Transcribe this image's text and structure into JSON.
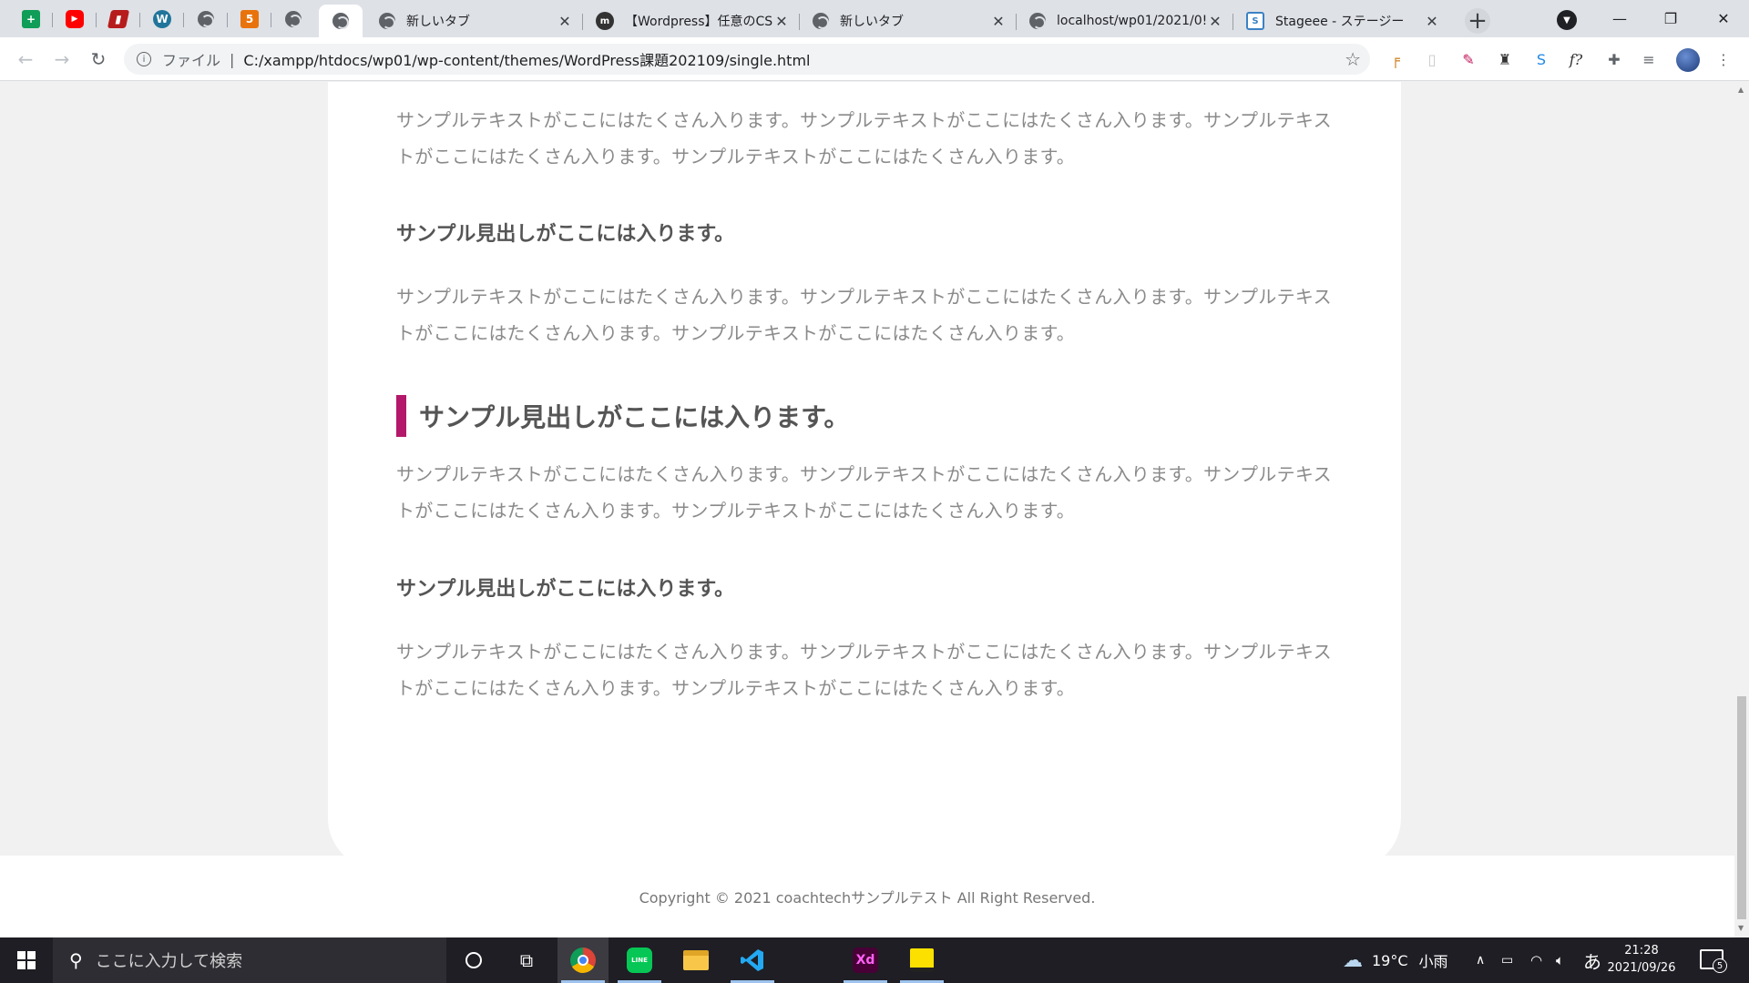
{
  "browser": {
    "pinned_tabs": [
      {
        "icon": "google-sheets-icon",
        "color": "#0f9d58",
        "glyph": "+"
      },
      {
        "icon": "youtube-icon",
        "color": "#ff0000",
        "glyph": "▶"
      },
      {
        "icon": "book-icon",
        "color": "#b71c1c",
        "glyph": "▮"
      },
      {
        "icon": "wordpress-icon",
        "color": "#21759b",
        "glyph": "W"
      },
      {
        "icon": "globe-icon"
      },
      {
        "icon": "html5-icon",
        "color": "#e8730c",
        "glyph": "5"
      },
      {
        "icon": "globe-icon"
      }
    ],
    "tabs": [
      {
        "title": "新しいタブ"
      },
      {
        "title": "【Wordpress】任意のCSS:"
      },
      {
        "title": "新しいタブ"
      },
      {
        "title": "localhost/wp01/2021/0!"
      },
      {
        "title": "Stageee - ステージー"
      }
    ],
    "new_tab": "+",
    "window": {
      "minimize": "—",
      "restore": "❐",
      "close": "✕"
    },
    "address": {
      "scheme_label": "ファイル",
      "url": "C:/xampp/htdocs/wp01/wp-content/themes/WordPress課題202109/single.html"
    },
    "extensions": [
      "ruler-icon",
      "bookmark-icon",
      "eyedropper-icon",
      "stamp-icon",
      "stylus-icon",
      "font-icon",
      "puzzle-icon",
      "media-control-icon"
    ],
    "font_ext_label": "f?"
  },
  "page": {
    "accent_color": "#b4186a",
    "blocks": [
      {
        "type": "p",
        "text": "サンプルテキストがここにはたくさん入ります。サンプルテキストがここにはたくさん入ります。サンプルテキストがここにはたくさん入ります。サンプルテキストがここにはたくさん入ります。"
      },
      {
        "type": "h3",
        "text": "サンプル見出しがここには入ります。"
      },
      {
        "type": "p",
        "text": "サンプルテキストがここにはたくさん入ります。サンプルテキストがここにはたくさん入ります。サンプルテキストがここにはたくさん入ります。サンプルテキストがここにはたくさん入ります。"
      },
      {
        "type": "h2",
        "text": "サンプル見出しがここには入ります。"
      },
      {
        "type": "p",
        "text": "サンプルテキストがここにはたくさん入ります。サンプルテキストがここにはたくさん入ります。サンプルテキストがここにはたくさん入ります。サンプルテキストがここにはたくさん入ります。"
      },
      {
        "type": "h3",
        "text": "サンプル見出しがここには入ります。"
      },
      {
        "type": "p",
        "text": "サンプルテキストがここにはたくさん入ります。サンプルテキストがここにはたくさん入ります。サンプルテキストがここにはたくさん入ります。サンプルテキストがここにはたくさん入ります。"
      }
    ],
    "footer": "Copyright © 2021 coachtechサンプルテスト All Right Reserved."
  },
  "taskbar": {
    "search_placeholder": "ここに入力して検索",
    "apps": [
      "cortana-icon",
      "task-view-icon",
      "chrome-icon",
      "line-icon",
      "file-explorer-icon",
      "vscode-icon",
      "adobe-xd-icon",
      "sticky-notes-icon"
    ],
    "xd_label": "Xd",
    "line_label": "LINE",
    "weather": {
      "temp": "19°C",
      "condition": "小雨"
    },
    "ime": "あ",
    "clock": {
      "time": "21:28",
      "date": "2021/09/26"
    },
    "notification_count": "5"
  }
}
